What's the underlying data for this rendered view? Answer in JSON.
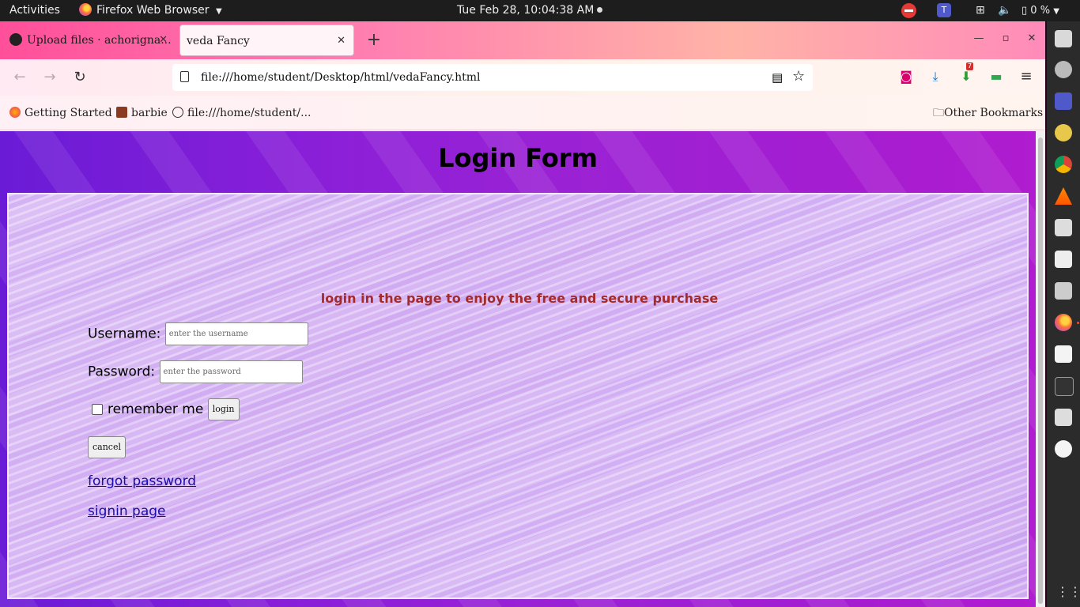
{
  "topbar": {
    "activities": "Activities",
    "app_name": "Firefox Web Browser",
    "clock": "Tue Feb 28, 10:04:38 AM",
    "battery": "0 %",
    "teams_label": "T"
  },
  "browser": {
    "tabs": [
      {
        "title": "Upload files · achorigna..."
      },
      {
        "title": "veda Fancy"
      }
    ],
    "url": "file:///home/student/Desktop/html/vedaFancy.html",
    "bookmarks": [
      {
        "label": "Getting Started"
      },
      {
        "label": "barbie"
      },
      {
        "label": "file:///home/student/..."
      }
    ],
    "other_bookmarks": "Other Bookmarks",
    "badge_count": "7"
  },
  "page": {
    "heading": "Login Form",
    "tagline": "login in the page to enjoy the free and secure purchase",
    "username_label": "Username:",
    "username_placeholder": "enter the username",
    "password_label": "Password:",
    "password_placeholder": "enter the password",
    "remember_label": "remember me",
    "login_button": "login",
    "cancel_button": "cancel",
    "forgot_link": "forgot password",
    "signin_link": "signin page"
  },
  "colors": {
    "tagline": "#a52a2a",
    "link": "#1a0dab",
    "tab_gradient_start": "#ff4f9a",
    "page_bg_purple": "#8a1fd8",
    "form_bg_lavender": "#d6b4f3"
  }
}
